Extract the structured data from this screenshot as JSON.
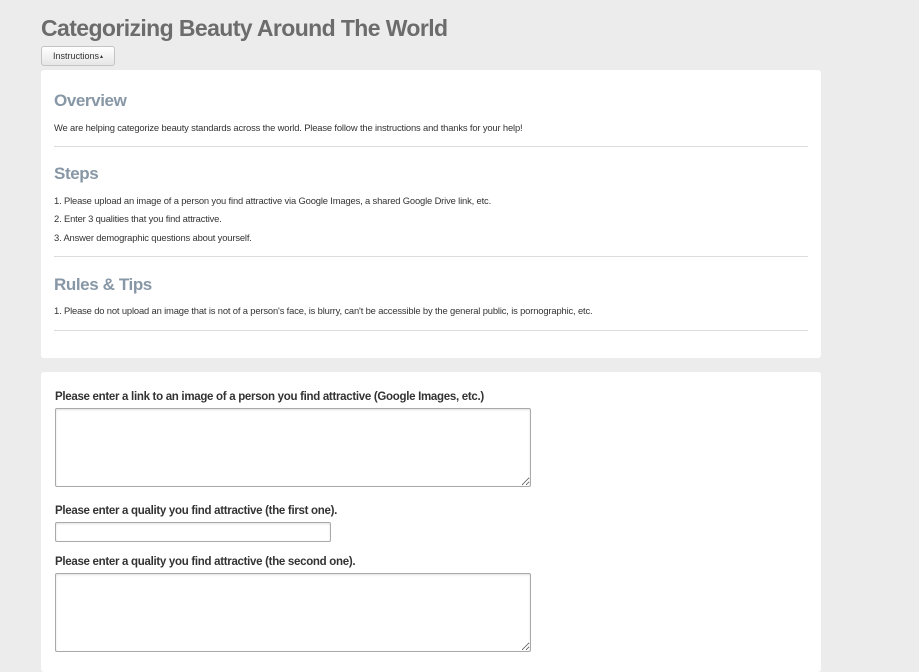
{
  "page": {
    "title": "Categorizing Beauty Around The World"
  },
  "toolbar": {
    "instructions_label": "Instructions",
    "instructions_caret": "▴"
  },
  "instructions": {
    "overview": {
      "heading": "Overview",
      "text": "We are helping categorize beauty standards across the world. Please follow the instructions and thanks for your help!"
    },
    "steps": {
      "heading": "Steps",
      "items": [
        "1. Please upload an image of a person you find attractive via Google Images, a shared Google Drive link, etc.",
        "2. Enter 3 qualities that you find attractive.",
        "3. Answer demographic questions about yourself."
      ]
    },
    "rules": {
      "heading": "Rules & Tips",
      "items": [
        "1. Please do not upload an image that is not of a person's face, is blurry, can't be accessible by the general public,  is pornographic, etc."
      ]
    }
  },
  "form": {
    "image_link": {
      "label": "Please enter a link to an image of a person you find attractive (Google Images, etc.)",
      "value": ""
    },
    "quality_first": {
      "label": "Please enter a quality you find attractive (the first one).",
      "value": ""
    },
    "quality_second": {
      "label": "Please enter a quality you find attractive (the second one).",
      "value": ""
    }
  }
}
